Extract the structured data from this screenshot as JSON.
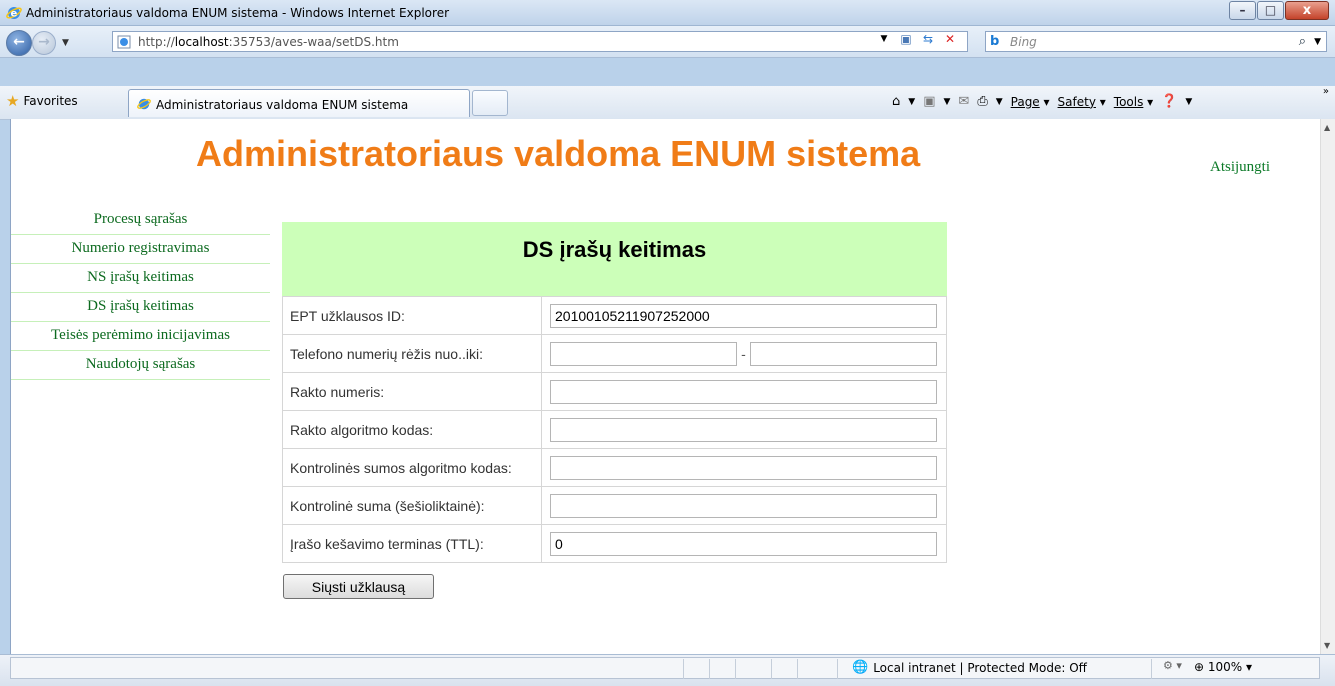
{
  "window": {
    "title": "Administratoriaus valdoma ENUM sistema - Windows Internet Explorer",
    "minimize": "–",
    "maximize": "□",
    "close": "x"
  },
  "address": {
    "url_prefix": "http://",
    "url_host": "localhost",
    "url_rest": ":35753/aves-waa/setDS.htm",
    "search_placeholder": "Bing"
  },
  "favorites": {
    "label": "Favorites",
    "tab_title": "Administratoriaus valdoma ENUM sistema"
  },
  "commandbar": {
    "page": "Page",
    "safety": "Safety",
    "tools": "Tools"
  },
  "page": {
    "title": "Administratoriaus valdoma ENUM sistema",
    "logout": "Atsijungti",
    "menu": [
      "Procesų sąrašas",
      "Numerio registravimas",
      "NS įrašų keitimas",
      "DS įrašų keitimas",
      "Teisės perėmimo inicijavimas",
      "Naudotojų sąrašas"
    ]
  },
  "form": {
    "heading": "DS įrašų keitimas",
    "fields": [
      {
        "label": "EPT užklausos ID:",
        "value": "20100105211907252000"
      },
      {
        "label": "Telefono numerių rėžis nuo..iki:",
        "from": "",
        "to": "",
        "separator": "-"
      },
      {
        "label": "Rakto numeris:",
        "value": ""
      },
      {
        "label": "Rakto algoritmo kodas:",
        "value": ""
      },
      {
        "label": "Kontrolinės sumos algoritmo kodas:",
        "value": ""
      },
      {
        "label": "Kontrolinė suma (šešioliktainė):",
        "value": ""
      },
      {
        "label": "Įrašo kešavimo terminas (TTL):",
        "value": "0"
      }
    ],
    "submit": "Siųsti užklausą"
  },
  "status": {
    "zone": "Local intranet | Protected Mode: Off",
    "zoom": "100%"
  },
  "colors": {
    "title_orange": "#f07c17",
    "menu_green": "#0c6a1f",
    "panel_header": "#ccffb9"
  }
}
